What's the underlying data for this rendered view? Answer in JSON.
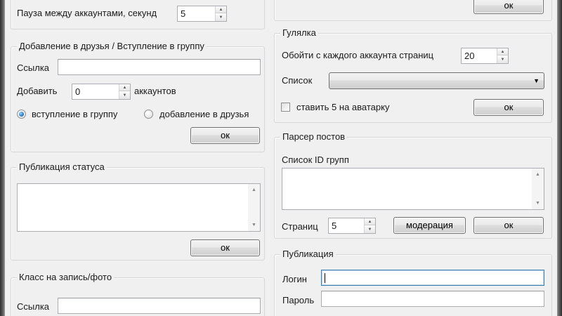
{
  "left": {
    "pause": {
      "label": "Пауза между аккаунтами, секунд",
      "value": "5"
    },
    "friends": {
      "title": "Добавление в друзья / Вступление в группу",
      "link_label": "Ссылка",
      "link_value": "",
      "add_label": "Добавить",
      "add_value": "0",
      "accounts_label": "аккаунтов",
      "radio_join": "вступление в группу",
      "radio_friend": "добавление в друзья",
      "ok": "ок"
    },
    "status": {
      "title": "Публикация статуса",
      "text": "",
      "ok": "ок"
    },
    "klass": {
      "title": "Класс на запись/фото",
      "link_label": "Ссылка",
      "link_value": ""
    }
  },
  "right": {
    "top_ok": "ок",
    "walker": {
      "title": "Гулялка",
      "pages_label": "Обойти с каждого аккаунта страниц",
      "pages_value": "20",
      "list_label": "Список",
      "list_value": "",
      "avatar_label": "ставить 5 на аватарку",
      "ok": "ок"
    },
    "parser": {
      "title": "Парсер постов",
      "groups_label": "Список ID групп",
      "groups_text": "",
      "pages_label": "Страниц",
      "pages_value": "5",
      "moderation": "модерация",
      "ok": "ок"
    },
    "publish": {
      "title": "Публикация",
      "login_label": "Логин",
      "login_value": "",
      "password_label": "Пароль",
      "password_value": ""
    }
  }
}
